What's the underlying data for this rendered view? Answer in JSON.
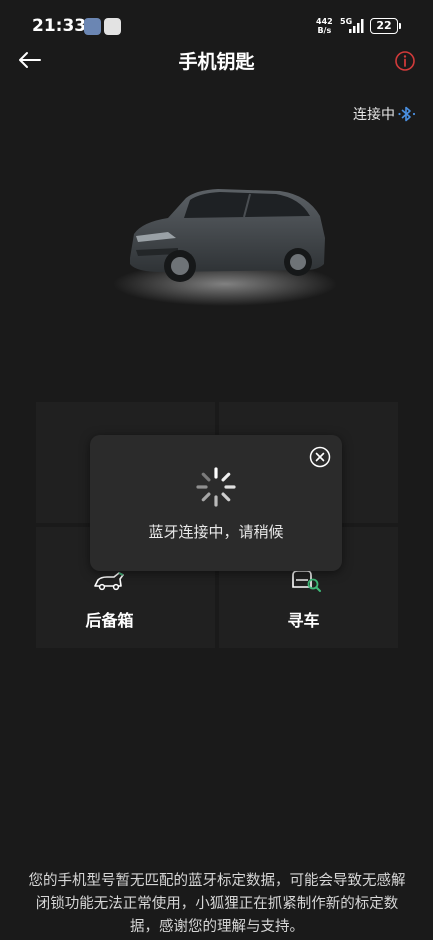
{
  "status_bar": {
    "time": "21:33",
    "net_speed_value": "442",
    "net_speed_unit": "B/s",
    "signal": "5G",
    "battery": "22"
  },
  "header": {
    "title": "手机钥匙",
    "back_icon": "arrow-left-icon",
    "info_icon": "info-circle-icon",
    "info_color": "#d03a3a"
  },
  "connection": {
    "status_text": "连接中",
    "icon": "bluetooth-icon"
  },
  "actions": [
    {
      "label": "后备箱",
      "icon": "trunk-icon"
    },
    {
      "label": "寻车",
      "icon": "find-car-icon"
    }
  ],
  "toast": {
    "message": "蓝牙连接中，请稍候",
    "close_icon": "close-circle-icon",
    "spinner_icon": "loading-spinner-icon"
  },
  "notice": "您的手机型号暂无匹配的蓝牙标定数据，可能会导致无感解闭锁功能无法正常使用，小狐狸正在抓紧制作新的标定数据，感谢您的理解与支持。"
}
